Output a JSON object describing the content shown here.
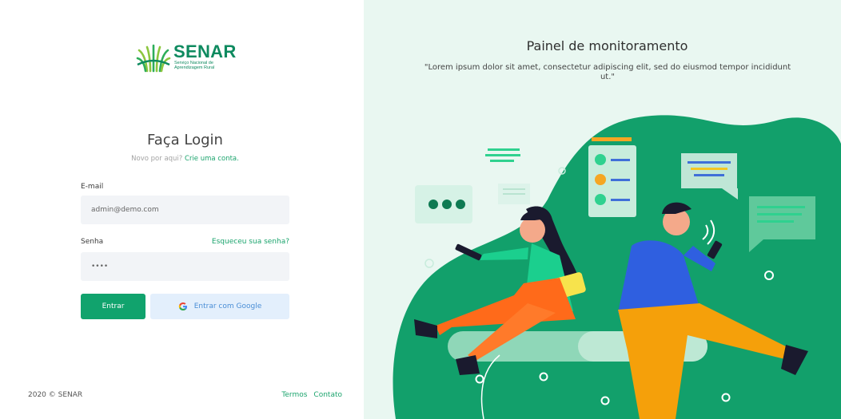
{
  "brand": {
    "name": "SENAR",
    "subtitle": "Serviço Nacional de Aprendizagem Rural",
    "primary_color": "#11a36d",
    "dark_green": "#0e8a5f"
  },
  "login": {
    "title": "Faça Login",
    "signup_prompt": "Novo por aqui?",
    "signup_link": "Crie uma conta.",
    "email_label": "E-mail",
    "email_value": "admin@demo.com",
    "password_label": "Senha",
    "forgot_link": "Esqueceu sua senha?",
    "password_value": "••••",
    "enter_button": "Entrar",
    "google_button": "Entrar com Google"
  },
  "footer": {
    "copyright": "2020 © SENAR",
    "terms_link": "Termos",
    "contact_link": "Contato"
  },
  "panel": {
    "title": "Painel de monitoramento",
    "quote": "\"Lorem ipsum dolor sit amet, consectetur adipiscing elit, sed do eiusmod tempor incididunt ut.\""
  },
  "icons": [
    "senar-logo-icon",
    "google-icon",
    "chat-bubble-icon",
    "contact-list-icon",
    "phone-icon",
    "signal-icon"
  ]
}
